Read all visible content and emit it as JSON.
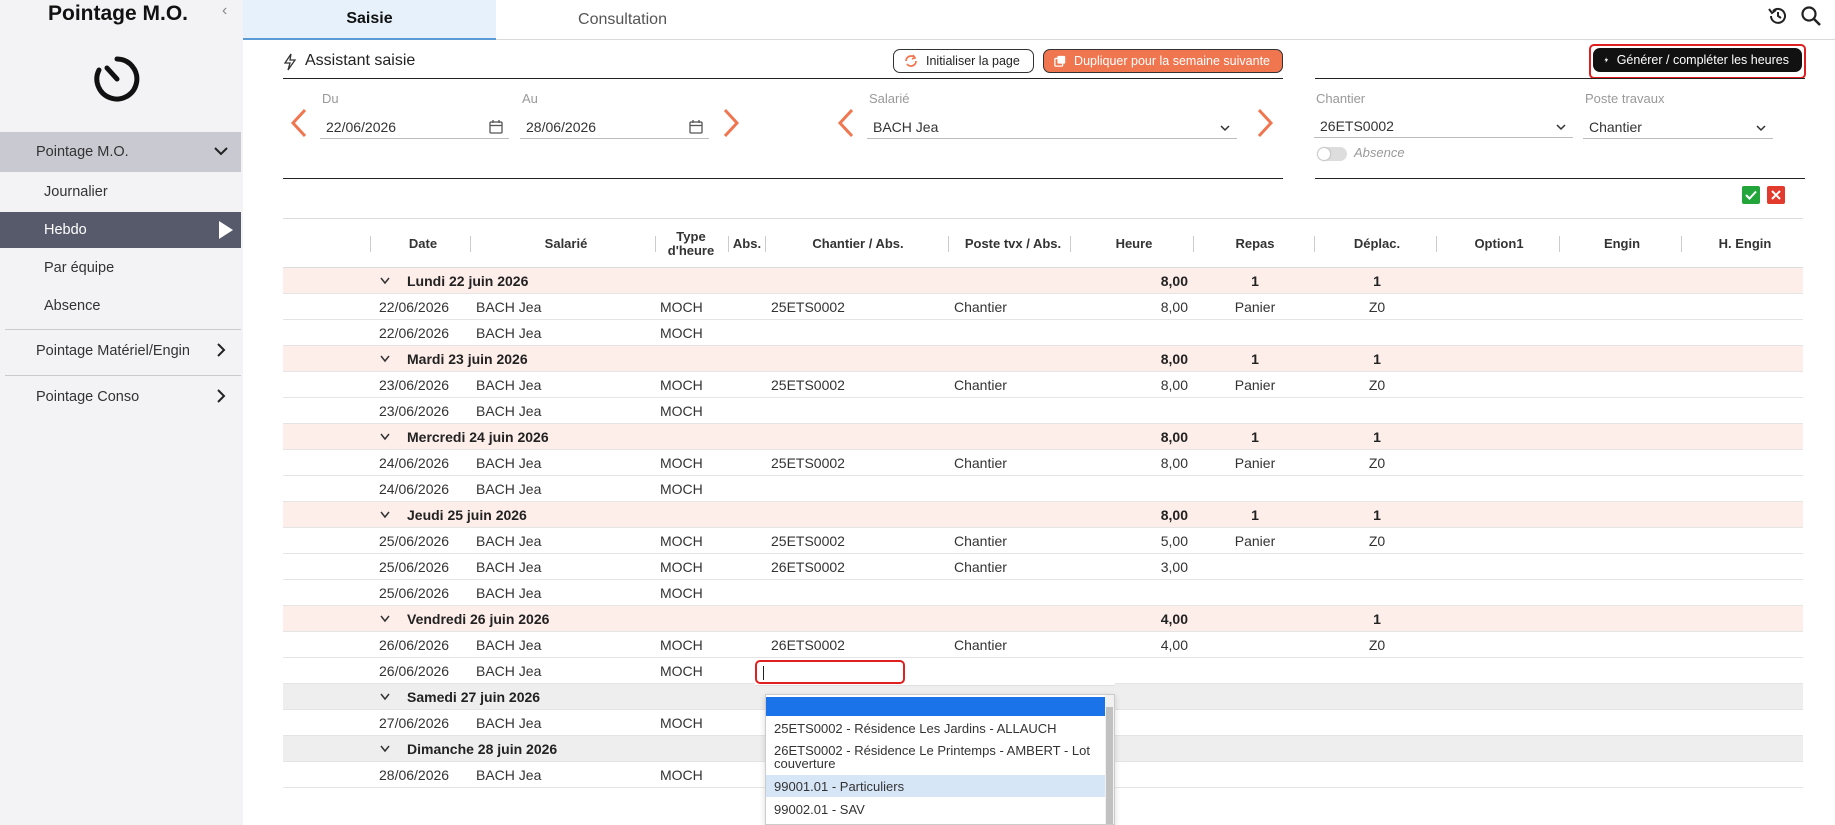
{
  "sidebar": {
    "title": "Pointage M.O.",
    "items": [
      {
        "label": "Pointage M.O."
      },
      {
        "label": "Journalier"
      },
      {
        "label": "Hebdo"
      },
      {
        "label": "Par équipe"
      },
      {
        "label": "Absence"
      },
      {
        "label": "Pointage Matériel/Engin"
      },
      {
        "label": "Pointage Conso"
      }
    ]
  },
  "tabs": [
    {
      "label": "Saisie"
    },
    {
      "label": "Consultation"
    }
  ],
  "assistant": {
    "title": "Assistant saisie",
    "init_button": "Initialiser la page",
    "duplicate_button": "Dupliquer pour la semaine suivante",
    "generate_button": "Générer / compléter les heures"
  },
  "filters": {
    "du_label": "Du",
    "du_value": "22/06/2026",
    "au_label": "Au",
    "au_value": "28/06/2026",
    "salarie_label": "Salarié",
    "salarie_value": "BACH Jea",
    "chantier_label": "Chantier",
    "chantier_value": "26ETS0002",
    "poste_label": "Poste travaux",
    "poste_value": "Chantier",
    "absence_label": "Absence"
  },
  "table": {
    "headers": [
      "Date",
      "Salarié",
      "Type d'heure",
      "Abs.",
      "Chantier / Abs.",
      "Poste tvx / Abs.",
      "Heure",
      "Repas",
      "Déplac.",
      "Option1",
      "Engin",
      "H. Engin"
    ],
    "rows": [
      {
        "type": "group",
        "label": "Lundi 22 juin 2026",
        "heure": "8,00",
        "repas": "1",
        "deplac": "1"
      },
      {
        "type": "row",
        "date": "22/06/2026",
        "salarie": "BACH Jea",
        "type_heure": "MOCH",
        "chantier": "25ETS0002",
        "poste": "Chantier",
        "heure": "8,00",
        "repas": "Panier",
        "deplac": "Z0"
      },
      {
        "type": "row",
        "date": "22/06/2026",
        "salarie": "BACH Jea",
        "type_heure": "MOCH"
      },
      {
        "type": "group",
        "label": "Mardi 23 juin 2026",
        "heure": "8,00",
        "repas": "1",
        "deplac": "1"
      },
      {
        "type": "row",
        "date": "23/06/2026",
        "salarie": "BACH Jea",
        "type_heure": "MOCH",
        "chantier": "25ETS0002",
        "poste": "Chantier",
        "heure": "8,00",
        "repas": "Panier",
        "deplac": "Z0"
      },
      {
        "type": "row",
        "date": "23/06/2026",
        "salarie": "BACH Jea",
        "type_heure": "MOCH"
      },
      {
        "type": "group",
        "label": "Mercredi 24 juin 2026",
        "heure": "8,00",
        "repas": "1",
        "deplac": "1"
      },
      {
        "type": "row",
        "date": "24/06/2026",
        "salarie": "BACH Jea",
        "type_heure": "MOCH",
        "chantier": "25ETS0002",
        "poste": "Chantier",
        "heure": "8,00",
        "repas": "Panier",
        "deplac": "Z0"
      },
      {
        "type": "row",
        "date": "24/06/2026",
        "salarie": "BACH Jea",
        "type_heure": "MOCH"
      },
      {
        "type": "group",
        "label": "Jeudi 25 juin 2026",
        "heure": "8,00",
        "repas": "1",
        "deplac": "1"
      },
      {
        "type": "row",
        "date": "25/06/2026",
        "salarie": "BACH Jea",
        "type_heure": "MOCH",
        "chantier": "25ETS0002",
        "poste": "Chantier",
        "heure": "5,00",
        "repas": "Panier",
        "deplac": "Z0"
      },
      {
        "type": "row",
        "date": "25/06/2026",
        "salarie": "BACH Jea",
        "type_heure": "MOCH",
        "chantier": "26ETS0002",
        "poste": "Chantier",
        "heure": "3,00"
      },
      {
        "type": "row",
        "date": "25/06/2026",
        "salarie": "BACH Jea",
        "type_heure": "MOCH"
      },
      {
        "type": "group",
        "label": "Vendredi 26 juin 2026",
        "heure": "4,00",
        "repas": "",
        "deplac": "1"
      },
      {
        "type": "row",
        "date": "26/06/2026",
        "salarie": "BACH Jea",
        "type_heure": "MOCH",
        "chantier": "26ETS0002",
        "poste": "Chantier",
        "heure": "4,00",
        "deplac": "Z0"
      },
      {
        "type": "row",
        "date": "26/06/2026",
        "salarie": "BACH Jea",
        "type_heure": "MOCH",
        "editing": true
      },
      {
        "type": "group",
        "weekend": true,
        "label": "Samedi 27 juin 2026"
      },
      {
        "type": "row",
        "date": "27/06/2026",
        "salarie": "BACH Jea",
        "type_heure": "MOCH"
      },
      {
        "type": "group",
        "weekend": true,
        "label": "Dimanche 28 juin 2026"
      },
      {
        "type": "row",
        "date": "28/06/2026",
        "salarie": "BACH Jea",
        "type_heure": "MOCH"
      }
    ]
  },
  "dropdown": {
    "options": [
      "",
      "25ETS0002 - Résidence Les Jardins - ALLAUCH",
      "26ETS0002 - Résidence Le Printemps - AMBERT - Lot couverture",
      "99001.01 - Particuliers",
      "99002.01 - SAV"
    ]
  },
  "colors": {
    "accent": "#f07650",
    "highlight": "#e02020",
    "selected": "#1a73e8",
    "confirm": "#22a63b",
    "cancel": "#e23b2e"
  }
}
